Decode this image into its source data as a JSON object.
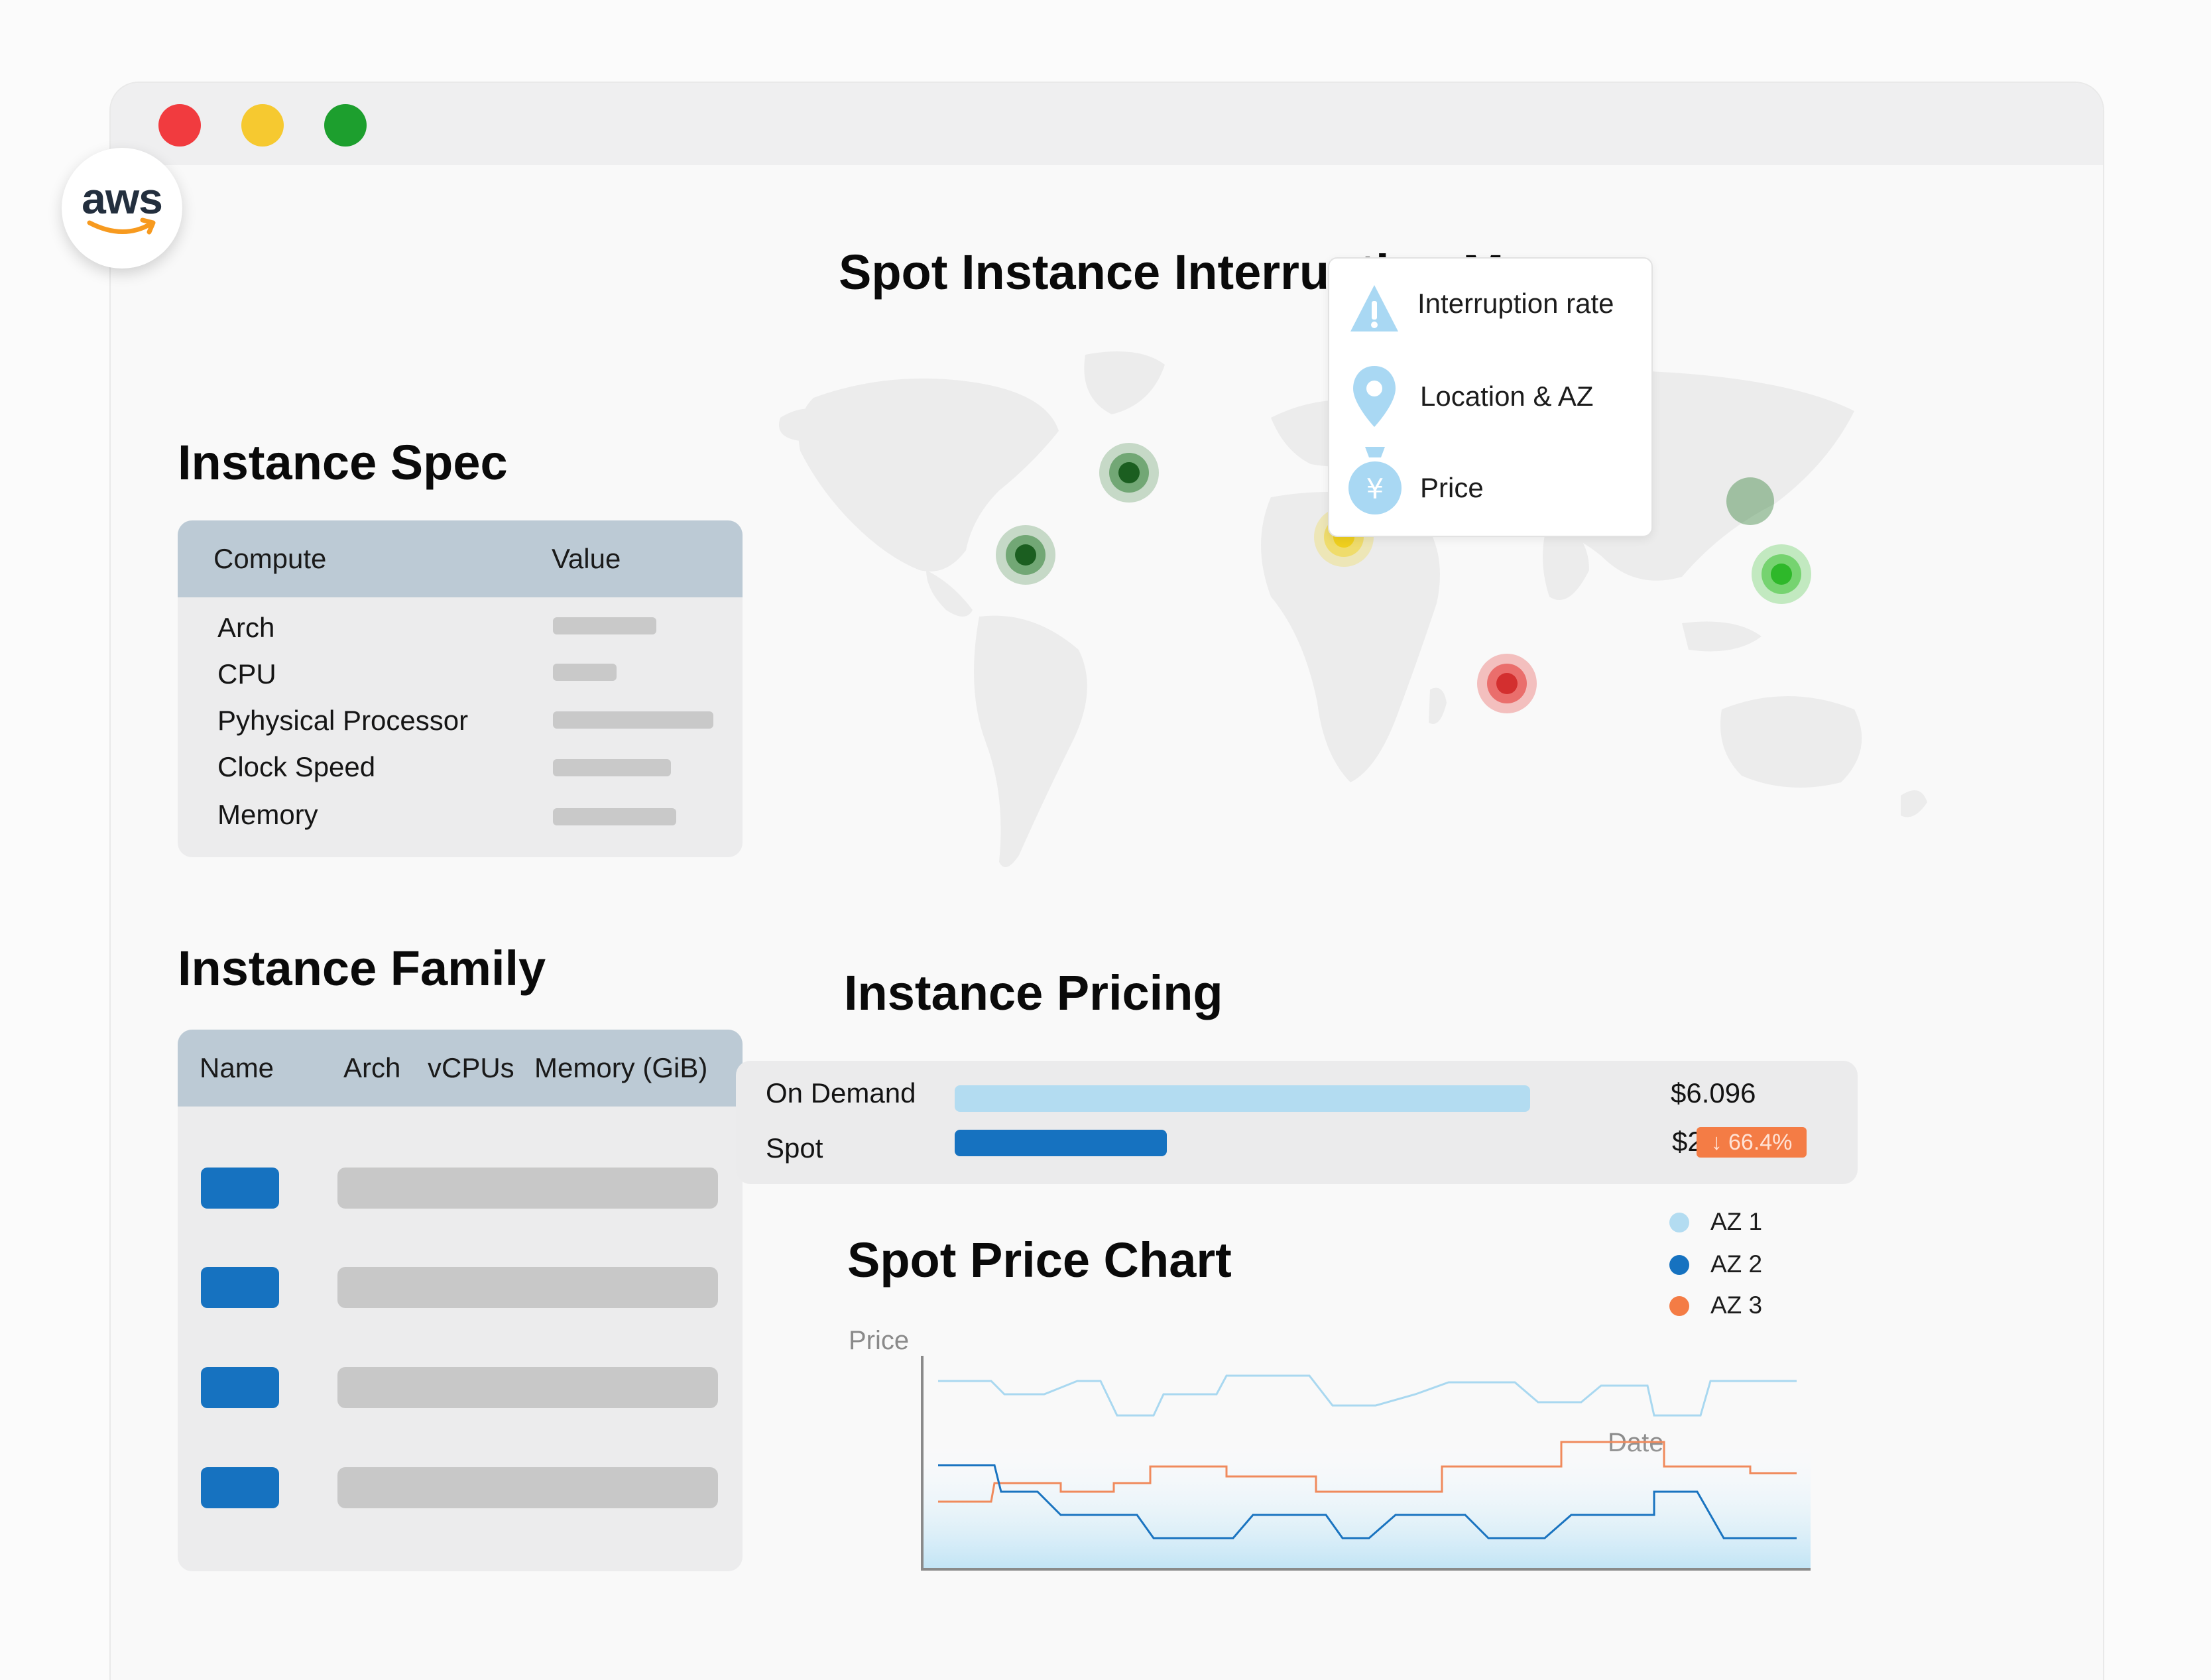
{
  "window": {
    "controls": [
      "close",
      "minimize",
      "maximize"
    ]
  },
  "logo": {
    "text": "aws",
    "icon": "aws-logo"
  },
  "instance_spec": {
    "title": "Instance Spec",
    "headers": {
      "compute": "Compute",
      "value": "Value"
    },
    "rows": [
      "Arch",
      "CPU",
      "Pyhysical Processor",
      "Clock Speed",
      "Memory"
    ]
  },
  "instance_family": {
    "title": "Instance Family",
    "headers": {
      "name": "Name",
      "arch": "Arch",
      "vcpus": "vCPUs",
      "memory": "Memory (GiB)"
    },
    "row_count": 4
  },
  "interruption_map": {
    "title": "Spot Instance Interruption Map",
    "legend": {
      "interruption_rate": "Interruption rate",
      "location": "Location & AZ",
      "price": "Price"
    },
    "marker_colors": [
      "#2e7d32",
      "#f2a64c",
      "#f0d63a",
      "#e53935",
      "#43c53a"
    ]
  },
  "pricing": {
    "title": "Instance Pricing",
    "on_demand": {
      "label": "On Demand",
      "value": "$6.096",
      "fraction": 1.0,
      "color": "#b3dcf1"
    },
    "spot": {
      "label": "Spot",
      "value": "$2.0494",
      "fraction": 0.336,
      "color": "#1672c0"
    },
    "discount": "↓ 66.4%"
  },
  "spot_chart": {
    "title": "Spot Price Chart",
    "y_axis": "Price",
    "x_axis": "Date",
    "legend": [
      {
        "label": "AZ 1",
        "color": "#b3dcf1"
      },
      {
        "label": "AZ 2",
        "color": "#1672c0"
      },
      {
        "label": "AZ 3",
        "color": "#f47c45"
      }
    ]
  }
}
